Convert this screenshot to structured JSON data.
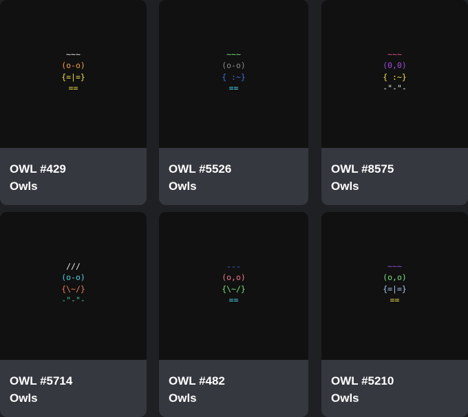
{
  "cards": [
    {
      "title": "OWL #429",
      "collection": "Owls",
      "art": [
        {
          "text": "~~~",
          "color": "#e8e8e8"
        },
        {
          "text": "(o-o)",
          "color": "#f0a24a"
        },
        {
          "text": "{=|=}",
          "color": "#f2e04a"
        },
        {
          "text": "==",
          "color": "#f2e04a"
        }
      ]
    },
    {
      "title": "OWL #5526",
      "collection": "Owls",
      "art": [
        {
          "text": "~~~",
          "color": "#7be07b"
        },
        {
          "text": "(o-o)",
          "color": "#8a8a8a"
        },
        {
          "text": "{ :~}",
          "color": "#3f6fe0"
        },
        {
          "text": "==",
          "color": "#4fd4f0"
        }
      ]
    },
    {
      "title": "OWL #8575",
      "collection": "Owls",
      "art": [
        {
          "text": "~~~",
          "color": "#e0508a"
        },
        {
          "text": "(0,0)",
          "color": "#9b4be0"
        },
        {
          "text": "{ :~}",
          "color": "#f2e04a"
        },
        {
          "text": "-\"-\"-",
          "color": "#e8e8e8"
        }
      ]
    },
    {
      "title": "OWL #5714",
      "collection": "Owls",
      "art": [
        {
          "text": "///",
          "color": "#e8e8e8"
        },
        {
          "text": "(o-o)",
          "color": "#4fd4e0"
        },
        {
          "text": "{\\~/}",
          "color": "#f07a5a"
        },
        {
          "text": "-\"-\"-",
          "color": "#4fc4a0"
        }
      ]
    },
    {
      "title": "OWL #482",
      "collection": "Owls",
      "art": [
        {
          "text": "---",
          "color": "#3f6fe0"
        },
        {
          "text": "(o,o)",
          "color": "#f07a8a"
        },
        {
          "text": "{\\~/}",
          "color": "#7be07b"
        },
        {
          "text": "==",
          "color": "#4fd4f0"
        }
      ]
    },
    {
      "title": "OWL #5210",
      "collection": "Owls",
      "art": [
        {
          "text": "~~~",
          "color": "#9b4be0"
        },
        {
          "text": "(o,o)",
          "color": "#7be07b"
        },
        {
          "text": "{=|=}",
          "color": "#a8c8f0"
        },
        {
          "text": "==",
          "color": "#f2e04a"
        }
      ]
    }
  ]
}
